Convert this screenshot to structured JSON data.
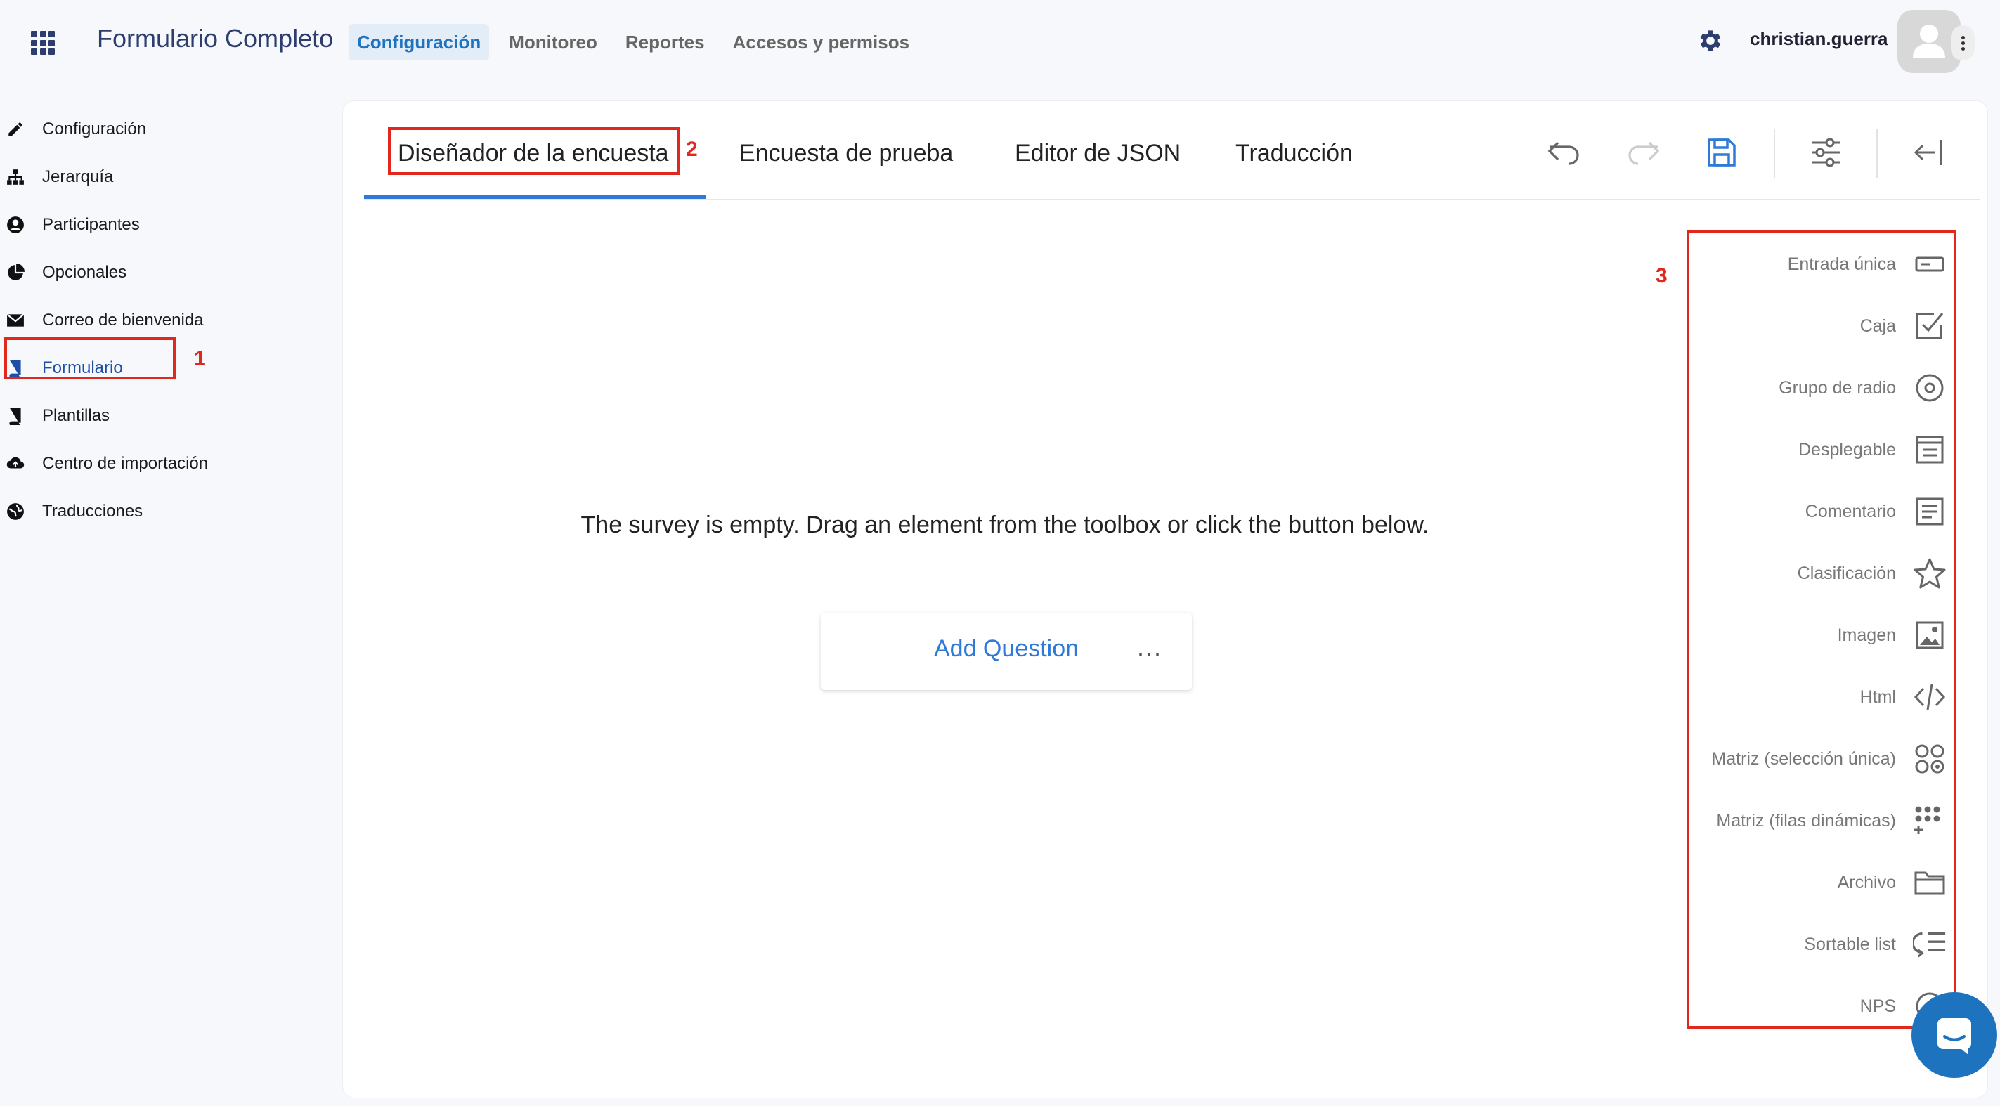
{
  "header": {
    "app_title": "Formulario Completo",
    "nav": [
      "Configuración",
      "Monitoreo",
      "Reportes",
      "Accesos y permisos"
    ],
    "active_nav": "Configuración",
    "user_name": "christian.guerra"
  },
  "sidebar": {
    "items": [
      {
        "label": "Configuración",
        "icon": "pencil-icon"
      },
      {
        "label": "Jerarquía",
        "icon": "hierarchy-icon"
      },
      {
        "label": "Participantes",
        "icon": "participant-icon"
      },
      {
        "label": "Opcionales",
        "icon": "pie-icon"
      },
      {
        "label": "Correo de bienvenida",
        "icon": "envelope-icon"
      },
      {
        "label": "Formulario",
        "icon": "book-icon"
      },
      {
        "label": "Plantillas",
        "icon": "book-dark-icon"
      },
      {
        "label": "Centro de importación",
        "icon": "cloud-upload-icon"
      },
      {
        "label": "Traducciones",
        "icon": "globe-icon"
      }
    ],
    "active_item": "Formulario"
  },
  "annotations": {
    "one": "1",
    "two": "2",
    "three": "3"
  },
  "editor": {
    "tabs": [
      "Diseñador de la encuesta",
      "Encuesta de prueba",
      "Editor de JSON",
      "Traducción"
    ],
    "active_tab": "Diseñador de la encuesta",
    "empty_message": "The survey is empty. Drag an element from the toolbox or click the button below.",
    "add_question_label": "Add Question",
    "more_label": "..."
  },
  "toolbox": {
    "items": [
      {
        "label": "Entrada única",
        "icon": "text-input-icon"
      },
      {
        "label": "Caja",
        "icon": "checkbox-icon"
      },
      {
        "label": "Grupo de radio",
        "icon": "radio-icon"
      },
      {
        "label": "Desplegable",
        "icon": "dropdown-icon"
      },
      {
        "label": "Comentario",
        "icon": "comment-icon"
      },
      {
        "label": "Clasificación",
        "icon": "star-icon"
      },
      {
        "label": "Imagen",
        "icon": "image-icon"
      },
      {
        "label": "Html",
        "icon": "code-icon"
      },
      {
        "label": "Matriz (selección única)",
        "icon": "matrix-single-icon"
      },
      {
        "label": "Matriz (filas dinámicas)",
        "icon": "matrix-dynamic-icon"
      },
      {
        "label": "Archivo",
        "icon": "folder-icon"
      },
      {
        "label": "Sortable list",
        "icon": "sortable-list-icon"
      },
      {
        "label": "NPS",
        "icon": "nps-icon"
      }
    ]
  },
  "colors": {
    "accent": "#2f7ad8",
    "annotation": "#e0281e",
    "brand_dark": "#2d3e6e"
  }
}
